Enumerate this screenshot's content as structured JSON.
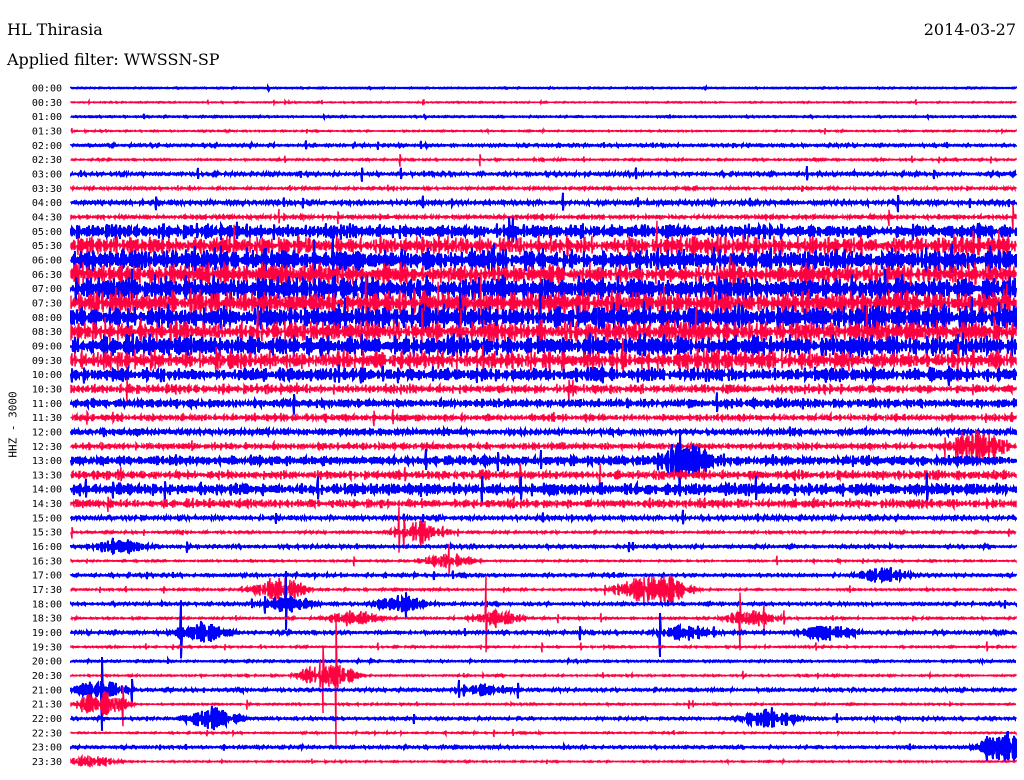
{
  "header": {
    "station": "HL Thirasia",
    "filter": "Applied filter: WWSSN-SP",
    "date": "2014-03-27"
  },
  "chart_data": {
    "type": "line",
    "title": "HL Thirasia helicorder",
    "ylabel": "HHZ - 3000",
    "row_labels": [
      "00:00",
      "00:30",
      "01:00",
      "01:30",
      "02:00",
      "02:30",
      "03:00",
      "03:30",
      "04:00",
      "04:30",
      "05:00",
      "05:30",
      "06:00",
      "06:30",
      "07:00",
      "07:30",
      "08:00",
      "08:30",
      "09:00",
      "09:30",
      "10:00",
      "10:30",
      "11:00",
      "11:30",
      "12:00",
      "12:30",
      "13:00",
      "13:30",
      "14:00",
      "14:30",
      "15:00",
      "15:30",
      "16:00",
      "16:30",
      "17:00",
      "17:30",
      "18:00",
      "18:30",
      "19:00",
      "19:30",
      "20:00",
      "20:30",
      "21:00",
      "21:30",
      "22:00",
      "22:30",
      "23:00",
      "23:30"
    ],
    "series_colors": [
      "#0000ff",
      "#ff0040"
    ],
    "relative_noise_amplitude": [
      0.3,
      0.5,
      0.4,
      0.6,
      0.7,
      0.8,
      1,
      1.2,
      1.5,
      2,
      6,
      8,
      9,
      9,
      10,
      10,
      10,
      9,
      9,
      8,
      6,
      4,
      3.5,
      3,
      2.5,
      3,
      4,
      4,
      5,
      4,
      1.2,
      1,
      0.8,
      0.7,
      0.7,
      0.8,
      0.8,
      0.8,
      0.9,
      0.7,
      0.5,
      0.7,
      0.8,
      0.7,
      0.7,
      0.6,
      0.7,
      0.6
    ],
    "events": [
      [
        31,
        0.37,
        4
      ],
      [
        32,
        0.05,
        3
      ],
      [
        33,
        0.4,
        3
      ],
      [
        34,
        0.86,
        3
      ],
      [
        35,
        0.22,
        5
      ],
      [
        35,
        0.6,
        4
      ],
      [
        35,
        0.63,
        5
      ],
      [
        36,
        0.23,
        3
      ],
      [
        36,
        0.35,
        3
      ],
      [
        37,
        0.3,
        3
      ],
      [
        37,
        0.45,
        3
      ],
      [
        37,
        0.72,
        3
      ],
      [
        38,
        0.14,
        4
      ],
      [
        38,
        0.65,
        3
      ],
      [
        38,
        0.8,
        3
      ],
      [
        41,
        0.27,
        6
      ],
      [
        42,
        0.03,
        4
      ],
      [
        42,
        0.44,
        2
      ],
      [
        43,
        0.03,
        5
      ],
      [
        44,
        0.15,
        4
      ],
      [
        44,
        0.74,
        4
      ],
      [
        46,
        0.99,
        6
      ],
      [
        47,
        0.02,
        2
      ],
      [
        26,
        0.65,
        6
      ],
      [
        25,
        0.96,
        6
      ]
    ]
  }
}
